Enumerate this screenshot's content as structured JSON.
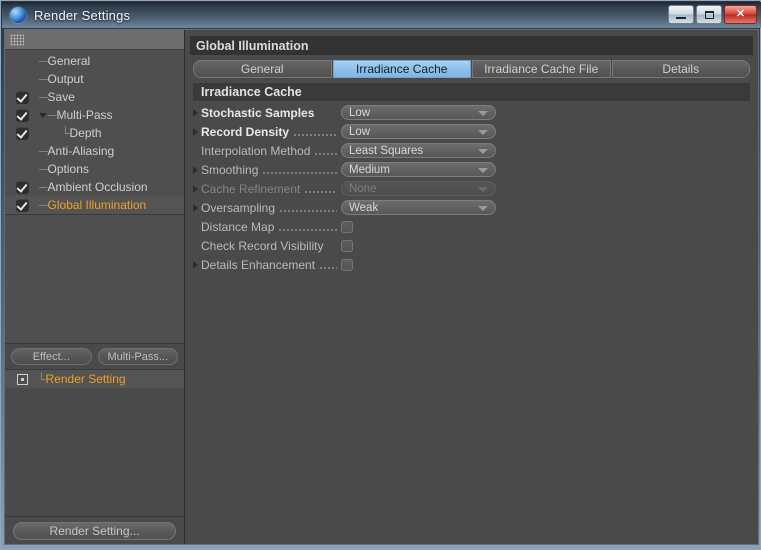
{
  "window": {
    "title": "Render Settings",
    "icon": "sphere-icon",
    "controls": {
      "minimize": "–",
      "maximize": "□",
      "close": "✕"
    }
  },
  "sidebar": {
    "grip": "drag-grip",
    "tree": [
      {
        "label": "General",
        "checkbox": "none",
        "indent": 1,
        "selected": false,
        "expander": "none"
      },
      {
        "label": "Output",
        "checkbox": "none",
        "indent": 1,
        "selected": false,
        "expander": "none"
      },
      {
        "label": "Save",
        "checkbox": "checked",
        "indent": 1,
        "selected": false,
        "expander": "none"
      },
      {
        "label": "Multi-Pass",
        "checkbox": "checked",
        "indent": 1,
        "selected": false,
        "expander": "down"
      },
      {
        "label": "Depth",
        "checkbox": "checked",
        "indent": 2,
        "selected": false,
        "expander": "none"
      },
      {
        "label": "Anti-Aliasing",
        "checkbox": "none",
        "indent": 1,
        "selected": false,
        "expander": "none"
      },
      {
        "label": "Options",
        "checkbox": "none",
        "indent": 1,
        "selected": false,
        "expander": "none"
      },
      {
        "label": "Ambient Occlusion",
        "checkbox": "checked",
        "indent": 1,
        "selected": false,
        "expander": "none"
      },
      {
        "label": "Global Illumination",
        "checkbox": "checked",
        "indent": 1,
        "selected": true,
        "expander": "none"
      }
    ],
    "buttons": {
      "effect": "Effect...",
      "multipass": "Multi-Pass..."
    },
    "render_setting_item": {
      "label": "Render Setting",
      "icon": "render-setting-icon",
      "selected": true
    },
    "footer_button": "Render Setting..."
  },
  "main": {
    "section_title": "Global Illumination",
    "tabs": [
      {
        "label": "General",
        "active": false
      },
      {
        "label": "Irradiance Cache",
        "active": true
      },
      {
        "label": "Irradiance Cache File",
        "active": false
      },
      {
        "label": "Details",
        "active": false
      }
    ],
    "group_title": "Irradiance Cache",
    "rows": [
      {
        "label": "Stochastic Samples",
        "type": "dropdown",
        "value": "Low",
        "emphasis": "strong",
        "expander": true,
        "disabled": false,
        "dots": false
      },
      {
        "label": "Record Density",
        "type": "dropdown",
        "value": "Low",
        "emphasis": "strong",
        "expander": true,
        "disabled": false,
        "dots": true
      },
      {
        "label": "Interpolation Method",
        "type": "dropdown",
        "value": "Least Squares",
        "emphasis": "normal",
        "expander": false,
        "disabled": false,
        "dots": true
      },
      {
        "label": "Smoothing",
        "type": "dropdown",
        "value": "Medium",
        "emphasis": "normal",
        "expander": true,
        "disabled": false,
        "dots": true
      },
      {
        "label": "Cache Refinement",
        "type": "dropdown",
        "value": "None",
        "emphasis": "dim",
        "expander": true,
        "disabled": true,
        "dots": true
      },
      {
        "label": "Oversampling",
        "type": "dropdown",
        "value": "Weak",
        "emphasis": "normal",
        "expander": true,
        "disabled": false,
        "dots": true
      },
      {
        "label": "Distance Map",
        "type": "checkbox",
        "value": "",
        "emphasis": "normal",
        "expander": false,
        "disabled": false,
        "dots": true
      },
      {
        "label": "Check Record Visibility",
        "type": "checkbox",
        "value": "",
        "emphasis": "normal",
        "expander": false,
        "disabled": false,
        "dots": false
      },
      {
        "label": "Details Enhancement",
        "type": "checkbox",
        "value": "",
        "emphasis": "normal",
        "expander": true,
        "disabled": false,
        "dots": true
      }
    ]
  },
  "colors": {
    "accent_selected": "#f0a01e",
    "tab_active": "#8dbfe8",
    "panel_bg": "#4a4a4a",
    "titlebar": "#2c3a47"
  }
}
